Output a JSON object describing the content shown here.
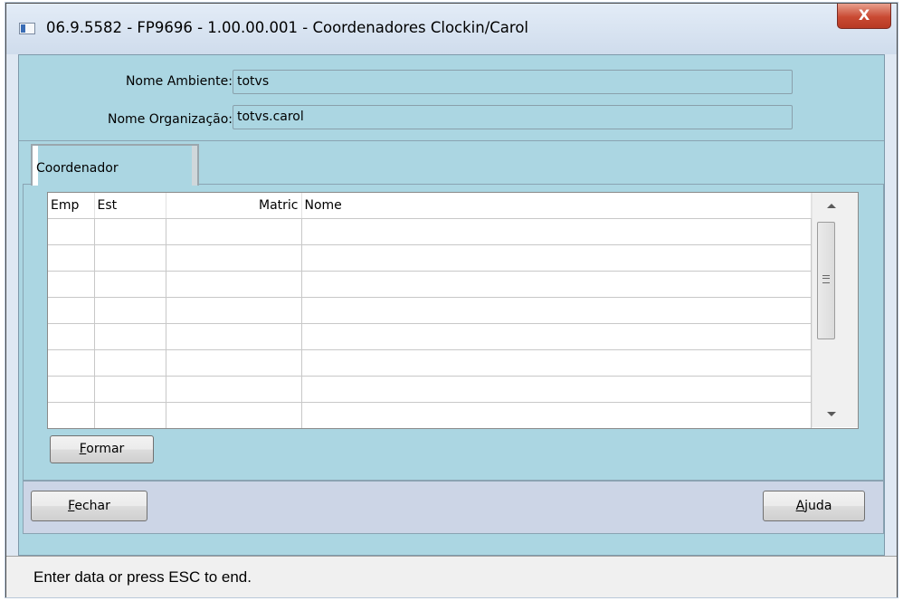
{
  "window": {
    "title": "06.9.5582 - FP9696 - 1.00.00.001 - Coordenadores Clockin/Carol",
    "close_label": "X"
  },
  "form": {
    "nome_ambiente_label": "Nome Ambiente:",
    "nome_ambiente_value": "totvs",
    "nome_organizacao_label": "Nome Organização:",
    "nome_organizacao_value": "totvs.carol"
  },
  "tabs": [
    {
      "label": "Coordenador",
      "active": true
    }
  ],
  "grid": {
    "columns": [
      "Emp",
      "Est",
      "Matric",
      "Nome"
    ],
    "rows": [
      [
        "",
        "",
        "",
        ""
      ],
      [
        "",
        "",
        "",
        ""
      ],
      [
        "",
        "",
        "",
        ""
      ],
      [
        "",
        "",
        "",
        ""
      ],
      [
        "",
        "",
        "",
        ""
      ],
      [
        "",
        "",
        "",
        ""
      ],
      [
        "",
        "",
        "",
        ""
      ],
      [
        "",
        "",
        "",
        ""
      ]
    ]
  },
  "buttons": {
    "formar_hotkey": "F",
    "formar_rest": "ormar",
    "fechar_hotkey": "F",
    "fechar_rest": "echar",
    "ajuda_hotkey": "A",
    "ajuda_rest": "juda"
  },
  "status_bar": {
    "message": "Enter data or press ESC to end."
  },
  "colors": {
    "panel": "#abd6e2",
    "footer_panel": "#ccd5e6"
  }
}
